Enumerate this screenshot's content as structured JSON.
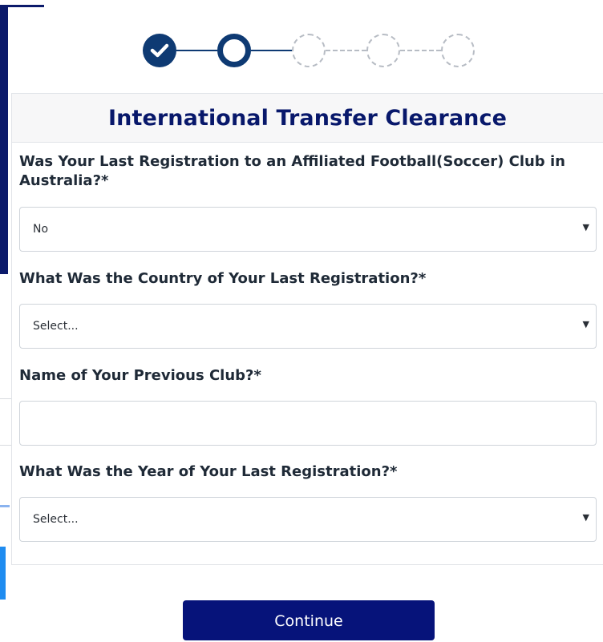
{
  "stepper": {
    "steps": [
      {
        "state": "done",
        "icon": "check-icon"
      },
      {
        "state": "current"
      },
      {
        "state": "pending"
      },
      {
        "state": "pending"
      },
      {
        "state": "pending"
      }
    ]
  },
  "card": {
    "title": "International Transfer Clearance"
  },
  "fields": {
    "last_registration_australia": {
      "label": "Was Your Last Registration to an Affiliated Football(Soccer) Club in Australia?*",
      "value": "No"
    },
    "country": {
      "label": "What Was the Country of Your Last Registration?*",
      "value": "Select..."
    },
    "previous_club": {
      "label": "Name of Your Previous Club?*",
      "value": ""
    },
    "year": {
      "label": "What Was the Year of Your Last Registration?*",
      "value": "Select..."
    }
  },
  "continue_label": "Continue",
  "colors": {
    "primary_navy": "#06137a",
    "title_navy": "#08186b",
    "step_navy": "#0e3a73",
    "pending_gray": "#b7bcc4"
  }
}
